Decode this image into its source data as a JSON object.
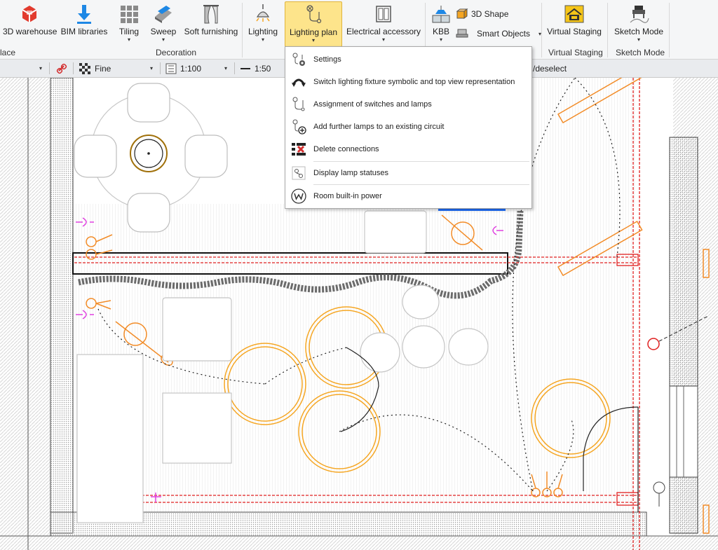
{
  "ribbon": {
    "buttons": [
      {
        "label": "3D warehouse",
        "icon": "sketchup-icon"
      },
      {
        "label": "BIM libraries",
        "icon": "download-icon"
      },
      {
        "label": "Tiling",
        "icon": "tiling-icon"
      },
      {
        "label": "Sweep",
        "icon": "sweep-icon"
      },
      {
        "label": "Soft furnishing",
        "icon": "curtain-icon"
      },
      {
        "label": "Lighting",
        "icon": "ceiling-lamp-icon"
      },
      {
        "label": "Lighting plan",
        "icon": "lighting-plan-icon"
      },
      {
        "label": "Electrical accessory",
        "icon": "socket-icon"
      },
      {
        "label": "KBB",
        "icon": "kitchen-icon"
      },
      {
        "label": "Virtual Staging",
        "icon": "virtual-staging-icon"
      },
      {
        "label": "Sketch Mode",
        "icon": "sketch-mode-icon"
      }
    ],
    "small_buttons": [
      {
        "label": "3D Shape",
        "icon": "3d-shape-icon"
      },
      {
        "label": "Smart Objects",
        "icon": "smart-objects-icon"
      }
    ],
    "groups": {
      "left": "lace",
      "decoration": "Decoration",
      "virtual_staging": "Virtual Staging",
      "sketch_mode": "Sketch Mode"
    }
  },
  "toolbar": {
    "quality": "Fine",
    "scale": "1:100",
    "line": "1:50",
    "hint": "/deselect"
  },
  "menu": {
    "items": [
      {
        "label": "Settings",
        "icon": "settings-lighting-icon"
      },
      {
        "label": "Switch lighting fixture symbolic and top view representation",
        "icon": "switch-representation-icon"
      },
      {
        "label": "Assignment of switches and lamps",
        "icon": "assign-switch-icon"
      },
      {
        "label": "Add further lamps to an existing circuit",
        "icon": "add-lamp-icon"
      },
      {
        "label": "Delete connections",
        "icon": "delete-connections-icon"
      },
      {
        "label": "Display lamp statuses",
        "icon": "lamp-status-icon"
      },
      {
        "label": "Room built-in power",
        "icon": "built-in-power-icon"
      }
    ]
  },
  "colors": {
    "ribbon_bg": "#f5f6f7",
    "active_button": "#fde48b",
    "lamp": "#f5a623",
    "wire": "#e02020",
    "switch": "#e040e0"
  }
}
